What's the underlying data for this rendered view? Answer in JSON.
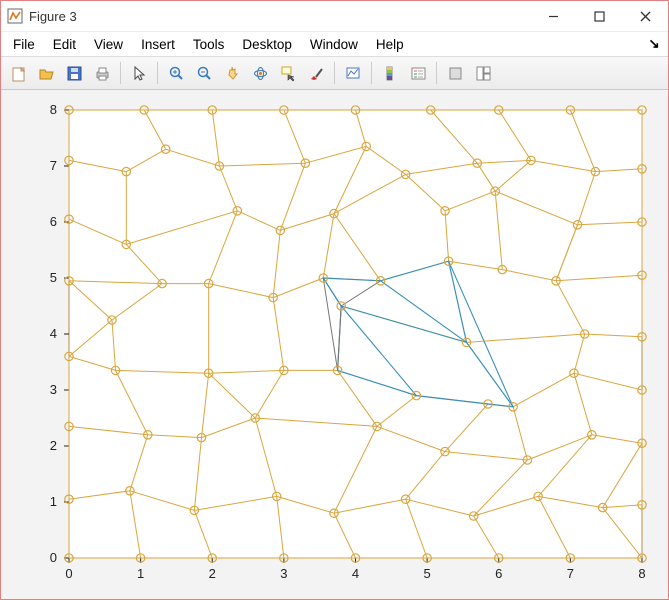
{
  "window": {
    "title": "Figure 3"
  },
  "menu": {
    "items": [
      "File",
      "Edit",
      "View",
      "Insert",
      "Tools",
      "Desktop",
      "Window",
      "Help"
    ],
    "dock_glyph": "↘"
  },
  "toolbar": {
    "items": [
      {
        "name": "new-figure-icon",
        "title": "New Figure"
      },
      {
        "name": "open-icon",
        "title": "Open"
      },
      {
        "name": "save-icon",
        "title": "Save"
      },
      {
        "name": "print-icon",
        "title": "Print"
      },
      "sep",
      {
        "name": "pointer-icon",
        "title": "Edit Plot"
      },
      "sep",
      {
        "name": "zoom-in-icon",
        "title": "Zoom In"
      },
      {
        "name": "zoom-out-icon",
        "title": "Zoom Out"
      },
      {
        "name": "pan-icon",
        "title": "Pan"
      },
      {
        "name": "rotate-3d-icon",
        "title": "Rotate 3D"
      },
      {
        "name": "data-cursor-icon",
        "title": "Data Cursor"
      },
      {
        "name": "brush-icon",
        "title": "Brush"
      },
      "sep",
      {
        "name": "link-plot-icon",
        "title": "Link Plot"
      },
      "sep",
      {
        "name": "colorbar-icon",
        "title": "Insert Colorbar"
      },
      {
        "name": "legend-icon",
        "title": "Insert Legend"
      },
      "sep",
      {
        "name": "hide-tools-icon",
        "title": "Hide Plot Tools"
      },
      {
        "name": "show-tools-icon",
        "title": "Show Plot Tools"
      }
    ]
  },
  "chart_data": {
    "type": "scatter",
    "xlim": [
      0,
      8
    ],
    "ylim": [
      0,
      8
    ],
    "xticks": [
      0,
      1,
      2,
      3,
      4,
      5,
      6,
      7,
      8
    ],
    "yticks": [
      0,
      1,
      2,
      3,
      4,
      5,
      6,
      7,
      8
    ],
    "nodes": [
      [
        0.0,
        8.0
      ],
      [
        1.05,
        8.0
      ],
      [
        2.0,
        8.0
      ],
      [
        3.0,
        8.0
      ],
      [
        4.0,
        8.0
      ],
      [
        5.05,
        8.0
      ],
      [
        6.0,
        8.0
      ],
      [
        7.0,
        8.0
      ],
      [
        8.0,
        8.0
      ],
      [
        0.0,
        7.1
      ],
      [
        0.8,
        6.9
      ],
      [
        1.35,
        7.3
      ],
      [
        2.1,
        7.0
      ],
      [
        3.3,
        7.05
      ],
      [
        4.15,
        7.35
      ],
      [
        4.7,
        6.85
      ],
      [
        5.7,
        7.05
      ],
      [
        6.45,
        7.1
      ],
      [
        7.35,
        6.9
      ],
      [
        8.0,
        6.95
      ],
      [
        0.0,
        6.05
      ],
      [
        0.8,
        5.6
      ],
      [
        2.35,
        6.2
      ],
      [
        2.95,
        5.85
      ],
      [
        3.7,
        6.15
      ],
      [
        5.25,
        6.2
      ],
      [
        5.95,
        6.55
      ],
      [
        7.1,
        5.95
      ],
      [
        8.0,
        6.0
      ],
      [
        0.0,
        4.95
      ],
      [
        1.3,
        4.9
      ],
      [
        1.95,
        4.9
      ],
      [
        2.85,
        4.65
      ],
      [
        3.55,
        5.0
      ],
      [
        4.35,
        4.95
      ],
      [
        5.3,
        5.3
      ],
      [
        6.05,
        5.15
      ],
      [
        6.8,
        4.95
      ],
      [
        8.0,
        5.05
      ],
      [
        0.6,
        4.25
      ],
      [
        3.8,
        4.5
      ],
      [
        5.55,
        3.85
      ],
      [
        7.2,
        4.0
      ],
      [
        8.0,
        3.95
      ],
      [
        0.0,
        3.6
      ],
      [
        0.65,
        3.35
      ],
      [
        1.95,
        3.3
      ],
      [
        3.0,
        3.35
      ],
      [
        3.75,
        3.35
      ],
      [
        4.85,
        2.9
      ],
      [
        5.85,
        2.75
      ],
      [
        6.2,
        2.7
      ],
      [
        7.05,
        3.3
      ],
      [
        8.0,
        3.0
      ],
      [
        0.0,
        2.35
      ],
      [
        1.1,
        2.2
      ],
      [
        1.85,
        2.15
      ],
      [
        2.6,
        2.5
      ],
      [
        4.3,
        2.35
      ],
      [
        5.25,
        1.9
      ],
      [
        6.4,
        1.75
      ],
      [
        7.3,
        2.2
      ],
      [
        8.0,
        2.05
      ],
      [
        0.0,
        1.05
      ],
      [
        0.85,
        1.2
      ],
      [
        1.75,
        0.85
      ],
      [
        2.9,
        1.1
      ],
      [
        3.7,
        0.8
      ],
      [
        4.7,
        1.05
      ],
      [
        5.65,
        0.75
      ],
      [
        6.55,
        1.1
      ],
      [
        7.45,
        0.9
      ],
      [
        8.0,
        0.95
      ],
      [
        0.0,
        0.0
      ],
      [
        1.0,
        0.0
      ],
      [
        2.0,
        0.0
      ],
      [
        3.0,
        0.0
      ],
      [
        4.0,
        0.0
      ],
      [
        5.0,
        0.0
      ],
      [
        6.0,
        0.0
      ],
      [
        7.0,
        0.0
      ],
      [
        8.0,
        0.0
      ]
    ],
    "links": [
      [
        0,
        1
      ],
      [
        1,
        2
      ],
      [
        2,
        3
      ],
      [
        3,
        4
      ],
      [
        4,
        5
      ],
      [
        5,
        6
      ],
      [
        6,
        7
      ],
      [
        7,
        8
      ],
      [
        0,
        9
      ],
      [
        1,
        11
      ],
      [
        2,
        12
      ],
      [
        3,
        13
      ],
      [
        4,
        14
      ],
      [
        5,
        16
      ],
      [
        6,
        17
      ],
      [
        7,
        18
      ],
      [
        8,
        19
      ],
      [
        9,
        10
      ],
      [
        10,
        11
      ],
      [
        11,
        12
      ],
      [
        12,
        13
      ],
      [
        13,
        14
      ],
      [
        14,
        15
      ],
      [
        15,
        16
      ],
      [
        16,
        17
      ],
      [
        17,
        18
      ],
      [
        18,
        19
      ],
      [
        9,
        20
      ],
      [
        10,
        21
      ],
      [
        12,
        22
      ],
      [
        13,
        23
      ],
      [
        14,
        24
      ],
      [
        15,
        24
      ],
      [
        15,
        25
      ],
      [
        16,
        26
      ],
      [
        17,
        26
      ],
      [
        18,
        27
      ],
      [
        19,
        28
      ],
      [
        20,
        21
      ],
      [
        21,
        22
      ],
      [
        22,
        23
      ],
      [
        23,
        24
      ],
      [
        24,
        33
      ],
      [
        25,
        26
      ],
      [
        26,
        27
      ],
      [
        27,
        28
      ],
      [
        20,
        29
      ],
      [
        21,
        30
      ],
      [
        22,
        31
      ],
      [
        23,
        32
      ],
      [
        24,
        34
      ],
      [
        25,
        35
      ],
      [
        26,
        36
      ],
      [
        27,
        37
      ],
      [
        28,
        38
      ],
      [
        37,
        27
      ],
      [
        29,
        30
      ],
      [
        30,
        31
      ],
      [
        31,
        32
      ],
      [
        32,
        33
      ],
      [
        33,
        34
      ],
      [
        35,
        36
      ],
      [
        36,
        37
      ],
      [
        37,
        38
      ],
      [
        29,
        39
      ],
      [
        30,
        39
      ],
      [
        31,
        46
      ],
      [
        32,
        47
      ],
      [
        37,
        42
      ],
      [
        38,
        43
      ],
      [
        39,
        45
      ],
      [
        39,
        44
      ],
      [
        40,
        41
      ],
      [
        41,
        42
      ],
      [
        42,
        43
      ],
      [
        42,
        52
      ],
      [
        44,
        45
      ],
      [
        45,
        46
      ],
      [
        46,
        47
      ],
      [
        47,
        48
      ],
      [
        49,
        50
      ],
      [
        50,
        51
      ],
      [
        51,
        52
      ],
      [
        52,
        53
      ],
      [
        44,
        54
      ],
      [
        45,
        55
      ],
      [
        46,
        56
      ],
      [
        46,
        57
      ],
      [
        47,
        57
      ],
      [
        48,
        58
      ],
      [
        49,
        58
      ],
      [
        48,
        40
      ],
      [
        50,
        59
      ],
      [
        51,
        60
      ],
      [
        52,
        61
      ],
      [
        53,
        62
      ],
      [
        54,
        55
      ],
      [
        55,
        56
      ],
      [
        56,
        57
      ],
      [
        57,
        58
      ],
      [
        58,
        59
      ],
      [
        59,
        60
      ],
      [
        60,
        61
      ],
      [
        61,
        62
      ],
      [
        54,
        63
      ],
      [
        55,
        64
      ],
      [
        56,
        65
      ],
      [
        57,
        66
      ],
      [
        58,
        67
      ],
      [
        59,
        68
      ],
      [
        60,
        69
      ],
      [
        61,
        70
      ],
      [
        62,
        71
      ],
      [
        62,
        72
      ],
      [
        63,
        64
      ],
      [
        64,
        65
      ],
      [
        65,
        66
      ],
      [
        66,
        67
      ],
      [
        67,
        68
      ],
      [
        68,
        69
      ],
      [
        69,
        70
      ],
      [
        70,
        71
      ],
      [
        71,
        72
      ],
      [
        63,
        73
      ],
      [
        64,
        74
      ],
      [
        65,
        75
      ],
      [
        66,
        76
      ],
      [
        67,
        77
      ],
      [
        68,
        78
      ],
      [
        69,
        79
      ],
      [
        70,
        80
      ],
      [
        71,
        81
      ],
      [
        73,
        74
      ],
      [
        74,
        75
      ],
      [
        75,
        76
      ],
      [
        76,
        77
      ],
      [
        77,
        78
      ],
      [
        78,
        79
      ],
      [
        79,
        80
      ],
      [
        80,
        81
      ]
    ],
    "highlight_poly": [
      [
        3.55,
        5.0
      ],
      [
        4.35,
        4.95
      ],
      [
        5.3,
        5.3
      ],
      [
        5.55,
        3.85
      ],
      [
        6.2,
        2.7
      ],
      [
        5.85,
        2.75
      ],
      [
        4.85,
        2.9
      ],
      [
        3.75,
        3.35
      ],
      [
        3.8,
        4.5
      ]
    ],
    "highlight_extra": [
      [
        [
          3.8,
          4.5
        ],
        [
          4.85,
          2.9
        ]
      ],
      [
        [
          3.8,
          4.5
        ],
        [
          5.55,
          3.85
        ]
      ],
      [
        [
          4.35,
          4.95
        ],
        [
          5.55,
          3.85
        ]
      ],
      [
        [
          3.55,
          5.0
        ],
        [
          3.8,
          4.5
        ]
      ],
      [
        [
          5.3,
          5.3
        ],
        [
          6.2,
          2.7
        ]
      ]
    ],
    "gray_extra": [
      [
        [
          3.55,
          5.0
        ],
        [
          3.75,
          3.35
        ]
      ],
      [
        [
          3.8,
          4.5
        ],
        [
          3.75,
          3.35
        ]
      ],
      [
        [
          4.35,
          4.95
        ],
        [
          3.8,
          4.5
        ]
      ]
    ]
  }
}
